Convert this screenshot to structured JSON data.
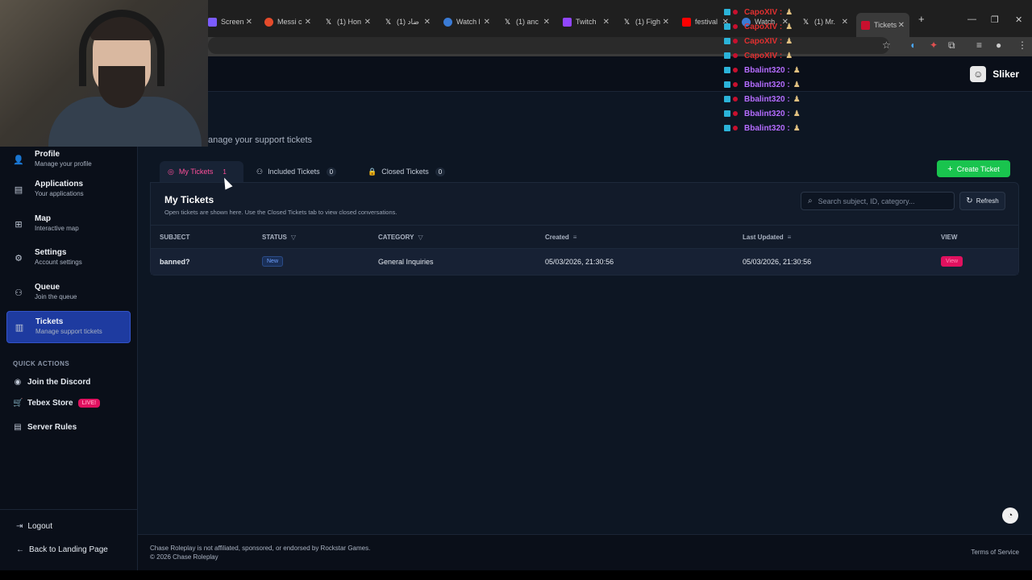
{
  "browser": {
    "tabs": [
      {
        "label": "Screen",
        "color": "#7b5cff",
        "icon": "screen-icon"
      },
      {
        "label": "Messi c",
        "color": "#e54b2b",
        "icon": "reddit-icon"
      },
      {
        "label": "(1) Hon",
        "color": "#222222",
        "icon": "x-icon"
      },
      {
        "label": "ضاد (1)",
        "color": "#222222",
        "icon": "x-icon"
      },
      {
        "label": "Watch l",
        "color": "#3a7bd5",
        "icon": "watch-icon"
      },
      {
        "label": "(1) anc",
        "color": "#222222",
        "icon": "x-icon"
      },
      {
        "label": "Twitch",
        "color": "#9146ff",
        "icon": "twitch-icon"
      },
      {
        "label": "(1) Figh",
        "color": "#222222",
        "icon": "x-icon"
      },
      {
        "label": "festival",
        "color": "#ff0000",
        "icon": "youtube-icon"
      },
      {
        "label": "Watch",
        "color": "#3a7bd5",
        "icon": "watch-icon"
      },
      {
        "label": "(1) Mr.",
        "color": "#222222",
        "icon": "x-icon"
      },
      {
        "label": "Tickets",
        "color": "#c8102e",
        "icon": "chase-icon"
      }
    ]
  },
  "chat": {
    "lines": [
      {
        "name": "CapoXIV :",
        "red": true
      },
      {
        "name": "CapoXIV :",
        "red": true
      },
      {
        "name": "CapoXIV :",
        "red": true
      },
      {
        "name": "CapoXIV :",
        "red": true
      },
      {
        "name": "Bbalint320 :",
        "red": false
      },
      {
        "name": "Bbalint320 :",
        "red": false
      },
      {
        "name": "Bbalint320 :",
        "red": false
      },
      {
        "name": "Bbalint320 :",
        "red": false
      },
      {
        "name": "Bbalint320 :",
        "red": false
      }
    ]
  },
  "header": {
    "username": "Sliker"
  },
  "sidebar": {
    "items": [
      {
        "title": "Profile",
        "sub": "Manage your profile",
        "icon": "user-icon"
      },
      {
        "title": "Applications",
        "sub": "Your applications",
        "icon": "document-icon"
      },
      {
        "title": "Map",
        "sub": "Interactive map",
        "icon": "map-icon"
      },
      {
        "title": "Settings",
        "sub": "Account settings",
        "icon": "gear-icon"
      },
      {
        "title": "Queue",
        "sub": "Join the queue",
        "icon": "users-icon"
      },
      {
        "title": "Tickets",
        "sub": "Manage support tickets",
        "icon": "ticket-icon"
      }
    ],
    "quick_actions_title": "QUICK ACTIONS",
    "quick_actions": [
      {
        "label": "Join the Discord",
        "icon": "discord-icon"
      },
      {
        "label": "Tebex Store",
        "icon": "cart-icon",
        "badge": "LIVE!"
      },
      {
        "label": "Server Rules",
        "icon": "rules-icon"
      }
    ],
    "logout": "Logout",
    "back": "Back to Landing Page"
  },
  "main": {
    "subtitle": "anage your support tickets",
    "tabs": [
      {
        "label": "My Tickets",
        "count": "1"
      },
      {
        "label": "Included Tickets",
        "count": "0"
      },
      {
        "label": "Closed Tickets",
        "count": "0"
      }
    ],
    "create_label": "Create Ticket",
    "panel": {
      "title": "My Tickets",
      "desc": "Open tickets are shown here. Use the Closed Tickets tab to view closed conversations.",
      "search_placeholder": "Search subject, ID, category...",
      "refresh_label": "Refresh",
      "columns": [
        "SUBJECT",
        "STATUS",
        "CATEGORY",
        "Created",
        "Last Updated",
        "VIEW"
      ],
      "rows": [
        {
          "subject": "banned?",
          "status": "New",
          "category": "General Inquiries",
          "created": "05/03/2026, 21:30:56",
          "updated": "05/03/2026, 21:30:56",
          "view": "View"
        }
      ]
    }
  },
  "footer": {
    "disclaimer": "Chase Roleplay is not affiliated, sponsored, or endorsed by Rockstar Games.",
    "copyright": "© 2026 Chase Roleplay",
    "terms": "Terms of Service"
  },
  "colors": {
    "accent": "#ff4f9a",
    "create": "#19c44e",
    "active_nav": "#1e3ba0",
    "view": "#e0115f"
  }
}
